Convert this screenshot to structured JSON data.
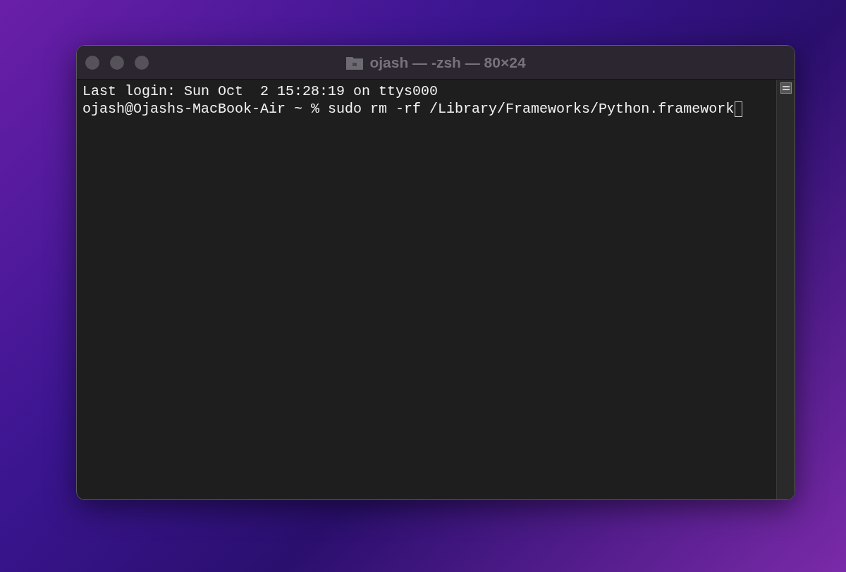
{
  "window": {
    "title": "ojash — -zsh — 80×24"
  },
  "terminal": {
    "lines": [
      {
        "text": "Last login: Sun Oct  2 15:28:19 on ttys000",
        "cursor": false
      },
      {
        "text": "ojash@Ojashs-MacBook-Air ~ % sudo rm -rf /Library/Frameworks/Python.framework",
        "cursor": true
      }
    ]
  }
}
